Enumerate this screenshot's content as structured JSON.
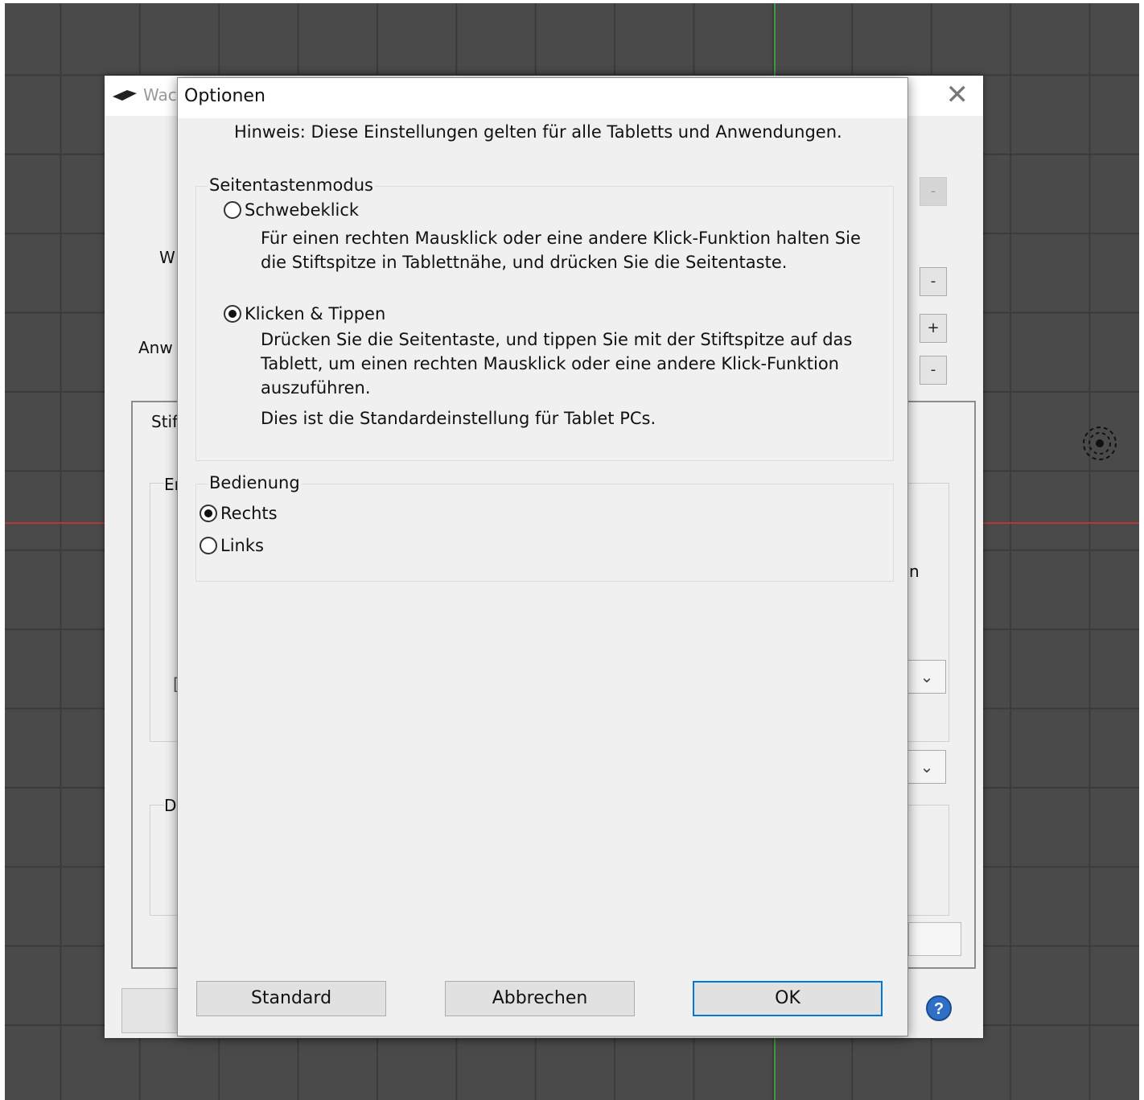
{
  "background_window": {
    "title": "Wac",
    "close_glyph": "✕",
    "labels": {
      "w": "W",
      "anw": "Anw",
      "stif": "Stif",
      "er": "Er",
      "d": "D",
      "n": "n",
      "bracket": "["
    },
    "side_buttons": [
      "-",
      "-",
      "+",
      "-"
    ],
    "dropdown_glyph": "⌄",
    "help_glyph": "?"
  },
  "dialog": {
    "title": "Optionen",
    "note": "Hinweis: Diese Einstellungen gelten für alle Tabletts und Anwendungen.",
    "side_button_mode": {
      "legend": "Seitentastenmodus",
      "hover_click": {
        "label": "Schwebeklick",
        "checked": false,
        "desc_line1": "Für einen rechten Mausklick oder eine andere Klick-Funktion halten Sie",
        "desc_line2": "die Stiftspitze in Tablettnähe, und drücken Sie die Seitentaste."
      },
      "click_tap": {
        "label": "Klicken & Tippen",
        "checked": true,
        "desc_line1": "Drücken Sie die Seitentaste, und tippen Sie mit der Stiftspitze auf das",
        "desc_line2": "Tablett, um einen rechten Mausklick oder eine andere Klick-Funktion",
        "desc_line3": "auszuführen.",
        "desc_line4": "Dies ist die Standardeinstellung für Tablet PCs."
      }
    },
    "handedness": {
      "legend": "Bedienung",
      "right": {
        "label": "Rechts",
        "checked": true
      },
      "left": {
        "label": "Links",
        "checked": false
      }
    },
    "buttons": {
      "standard": "Standard",
      "cancel": "Abbrechen",
      "ok": "OK"
    }
  }
}
